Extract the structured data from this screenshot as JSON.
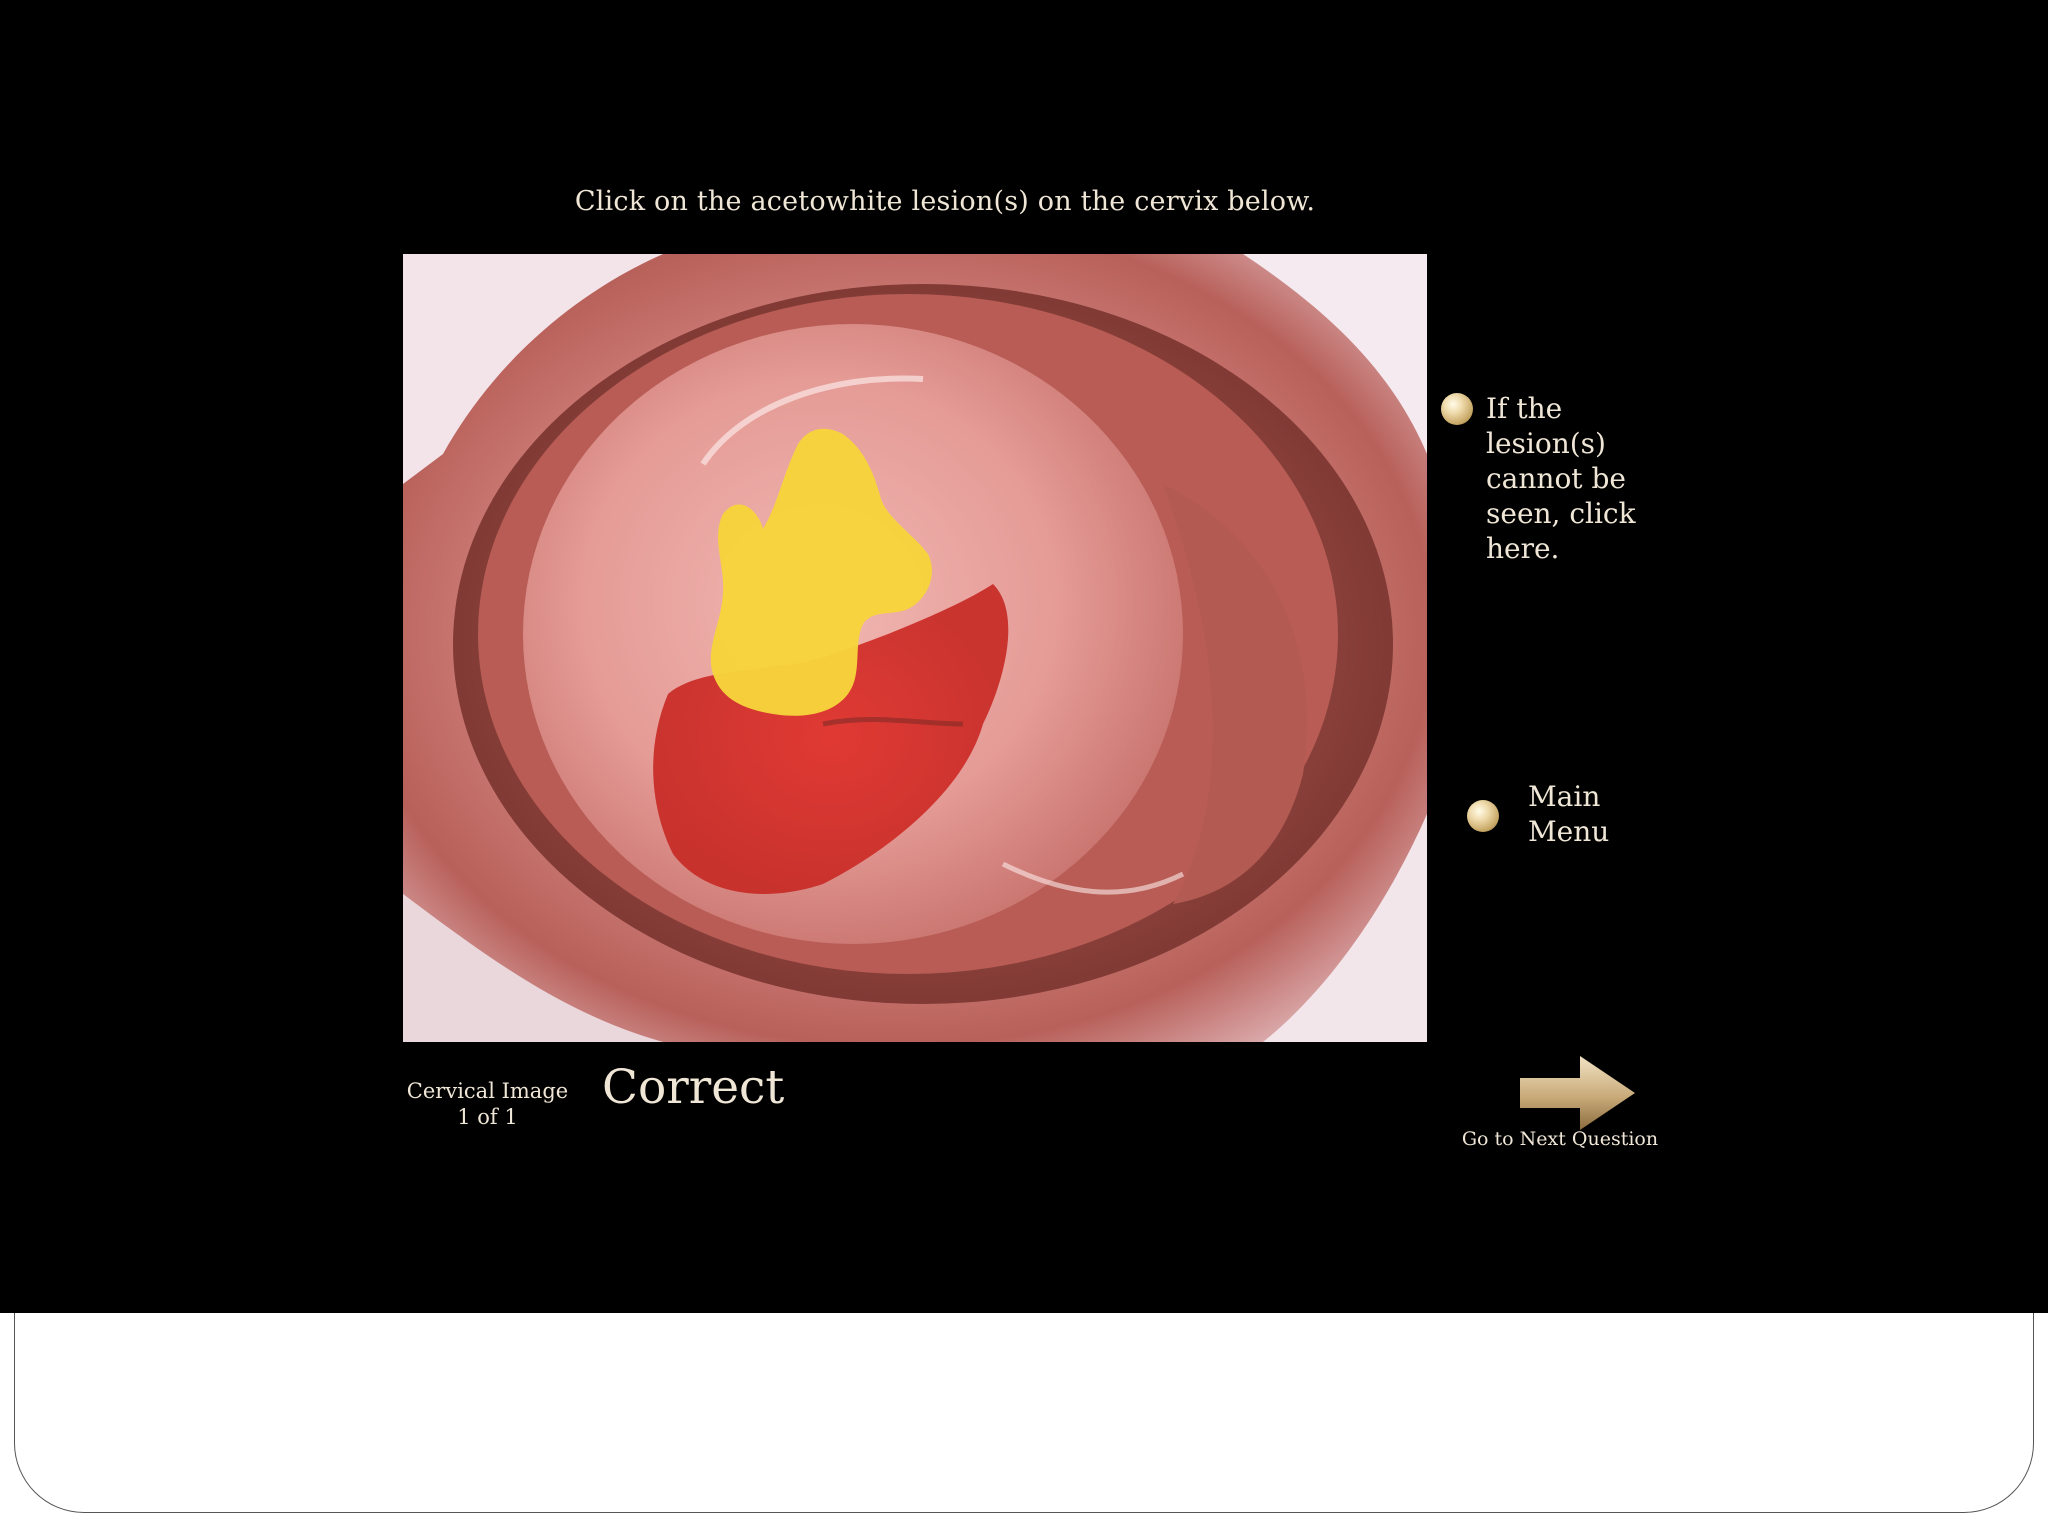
{
  "instruction": "Click on the acetowhite lesion(s) on the cervix below.",
  "options": {
    "cannot_see": "If the lesion(s) cannot be seen, click here.",
    "main_menu": "Main Menu"
  },
  "image_counter": {
    "title": "Cervical Image",
    "count": "1 of 1"
  },
  "result": "Correct",
  "next_label": "Go to Next Question",
  "colors": {
    "background": "#000000",
    "text": "#efe6d6",
    "lesion_highlight": "#f7d43c",
    "bullet": "#d8bd82"
  }
}
